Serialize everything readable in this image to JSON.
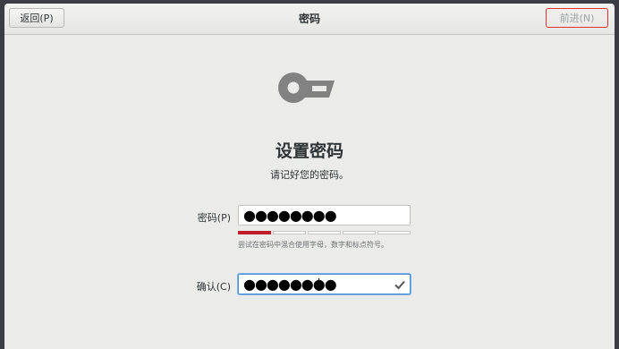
{
  "header": {
    "back_label": "返回(P)",
    "title": "密码",
    "next_label": "前进(N)"
  },
  "icon": {
    "name": "key-icon"
  },
  "main": {
    "title": "设置密码",
    "subtitle": "请记好您的密码。",
    "password_label": "密码(P)",
    "password_mask": "●●●●●●●●",
    "strength_level": 0.2,
    "hint": "尝试在密码中混合使用字母，数字和标点符号。",
    "confirm_label": "确认(C)",
    "confirm_mask": "●●●●●●●●"
  },
  "colors": {
    "strength_bar": "#c01c28",
    "focus_border": "#4a90d9",
    "highlight_box": "#dd3333"
  }
}
